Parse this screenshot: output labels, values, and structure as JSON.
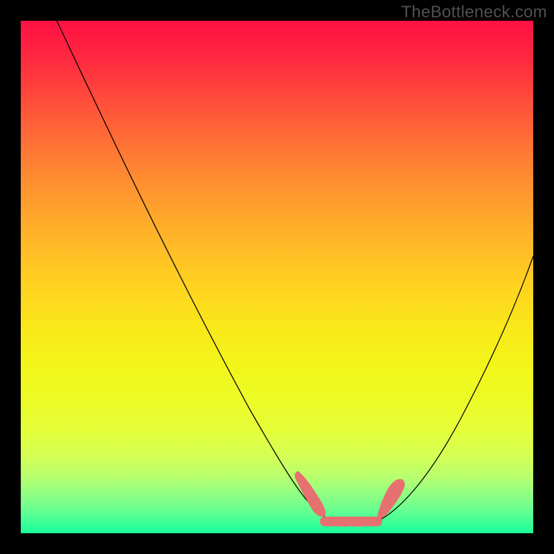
{
  "watermark": "TheBottleneck.com",
  "chart_data": {
    "type": "line",
    "title": "",
    "xlabel": "",
    "ylabel": "",
    "xlim": [
      0,
      100
    ],
    "ylim": [
      0,
      100
    ],
    "grid": false,
    "legend": false,
    "left_curve": {
      "description": "descending line from upper-left to bottom-center",
      "x": [
        7,
        15,
        25,
        35,
        45,
        52,
        56,
        58
      ],
      "y": [
        100,
        84,
        64,
        44,
        24,
        10,
        5,
        3
      ]
    },
    "right_curve": {
      "description": "ascending curve from bottom-center up to the right edge",
      "x": [
        70,
        75,
        80,
        85,
        90,
        95,
        100
      ],
      "y": [
        3,
        6,
        12,
        22,
        34,
        45,
        56
      ]
    },
    "bottom_highlights": {
      "description": "salmon/pink thick marker segments near the minimum",
      "segments": [
        {
          "x": [
            54,
            58
          ],
          "y": [
            8,
            3
          ]
        },
        {
          "x": [
            58,
            70
          ],
          "y": [
            2,
            2
          ]
        },
        {
          "x": [
            70,
            74
          ],
          "y": [
            3,
            7
          ]
        }
      ]
    },
    "background_gradient": {
      "top_color": "#ff1044",
      "mid_color": "#ffd31f",
      "bottom_color": "#18ff9b"
    }
  }
}
